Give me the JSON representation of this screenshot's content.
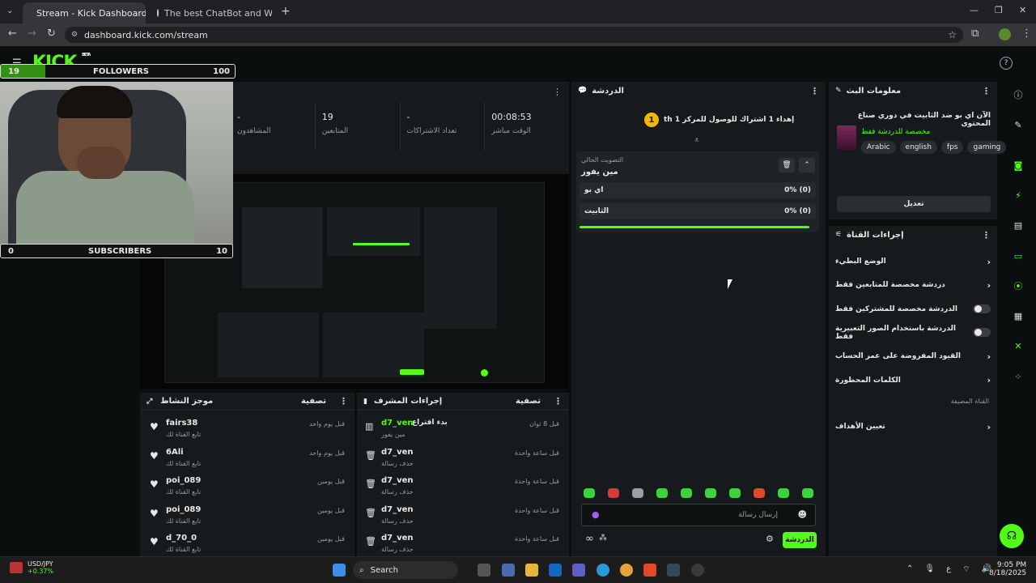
{
  "browser": {
    "tabs": [
      {
        "label": "Stream - Kick Dashboard",
        "active": true
      },
      {
        "label": "The best ChatBot and Widgets",
        "active": false
      }
    ],
    "url": "dashboard.kick.com/stream",
    "new_tab": "+"
  },
  "overlay": {
    "logo": "KICK",
    "logo_beta": "BETA",
    "followers_current": "19",
    "followers_label": "FOLLOWERS",
    "followers_goal": "100",
    "subs_current": "0",
    "subs_label": "SUBSCRIBERS",
    "subs_goal": "10"
  },
  "stats": [
    {
      "value": "-",
      "label": "المشاهدون"
    },
    {
      "value": "19",
      "label": "المتابعين"
    },
    {
      "value": "-",
      "label": "تعداد الاشتراكات"
    },
    {
      "value": "00:08:53",
      "label": "الوقت مباشر"
    }
  ],
  "chat": {
    "title": "الدردشة",
    "goal_badge": "1",
    "goal_text": "إهداء 1 اشتراك للوصول للمركز 1 th",
    "poll_title": "التصويت الحالي",
    "poll_question": "مين يفوز",
    "poll_options": [
      {
        "label": "اي بو",
        "result": "0% (0)"
      },
      {
        "label": "الثابيت",
        "result": "0% (0)"
      }
    ],
    "input_placeholder": "إرسال رسالة",
    "send_label": "الدردشة"
  },
  "stream_info": {
    "title": "معلومات البث",
    "stream_title": "الآن اي بو ضد الثابيت في دوري صناع المحتوى",
    "category": "مخصصة للدردشة فقط",
    "tags": [
      "Arabic",
      "english",
      "fps",
      "gaming"
    ],
    "edit_label": "تعديل"
  },
  "channel_actions": {
    "title": "إجراءات القناة",
    "items": [
      {
        "label": "الوضع البطيء",
        "control": "chevron"
      },
      {
        "label": "دردشة مخصصة للمتابعين فقط",
        "control": "chevron"
      },
      {
        "label": "الدردشة مخصصة للمشتركين فقط",
        "control": "toggle"
      },
      {
        "label": "الدردشة باستخدام الصور التعبيرية فقط",
        "control": "toggle"
      },
      {
        "label": "القيود المفروضة على عمر الحساب",
        "control": "chevron"
      },
      {
        "label": "الكلمات المحظورة",
        "control": "chevron"
      }
    ],
    "section_label": "القناة المضيفة",
    "goals_label": "تعيين الأهداف"
  },
  "activity": {
    "title": "موجز النشاط",
    "filter": "تصفية",
    "items": [
      {
        "user": "fairs38",
        "action": "تابع القناة لك",
        "time": "قبل يوم واحد"
      },
      {
        "user": "6Ali",
        "action": "تابع القناة لك",
        "time": "قبل يوم واحد"
      },
      {
        "user": "poi_089",
        "action": "تابع القناة لك",
        "time": "قبل يومين"
      },
      {
        "user": "poi_089",
        "action": "تابع القناة لك",
        "time": "قبل يومين"
      },
      {
        "user": "d_70_0",
        "action": "تابع القناة لك",
        "time": "قبل يومين"
      }
    ]
  },
  "mod_actions": {
    "title": "إجراءات المشرف",
    "filter": "تصفية",
    "items": [
      {
        "user": "d7_ven",
        "action_head": "بدء اقتراع",
        "action": "مين يفوز",
        "time": "قبل 8 ثوان"
      },
      {
        "user": "d7_ven",
        "action": "حذف رسالة",
        "time": "قبل ساعة واحدة"
      },
      {
        "user": "d7_ven",
        "action": "حذف رسالة",
        "time": "قبل ساعة واحدة"
      },
      {
        "user": "d7_ven",
        "action": "حذف رسالة",
        "time": "قبل ساعة واحدة"
      },
      {
        "user": "d7_ven",
        "action": "حذف رسالة",
        "time": "قبل ساعة واحدة"
      }
    ]
  },
  "taskbar": {
    "ticker": "USD/JPY",
    "ticker_change": "+0.37%",
    "search": "Search",
    "time": "9:05 PM",
    "date": "8/18/2025"
  },
  "colors": {
    "accent": "#53fc18",
    "panel": "#171a1c",
    "bg": "#0b0e0f"
  }
}
